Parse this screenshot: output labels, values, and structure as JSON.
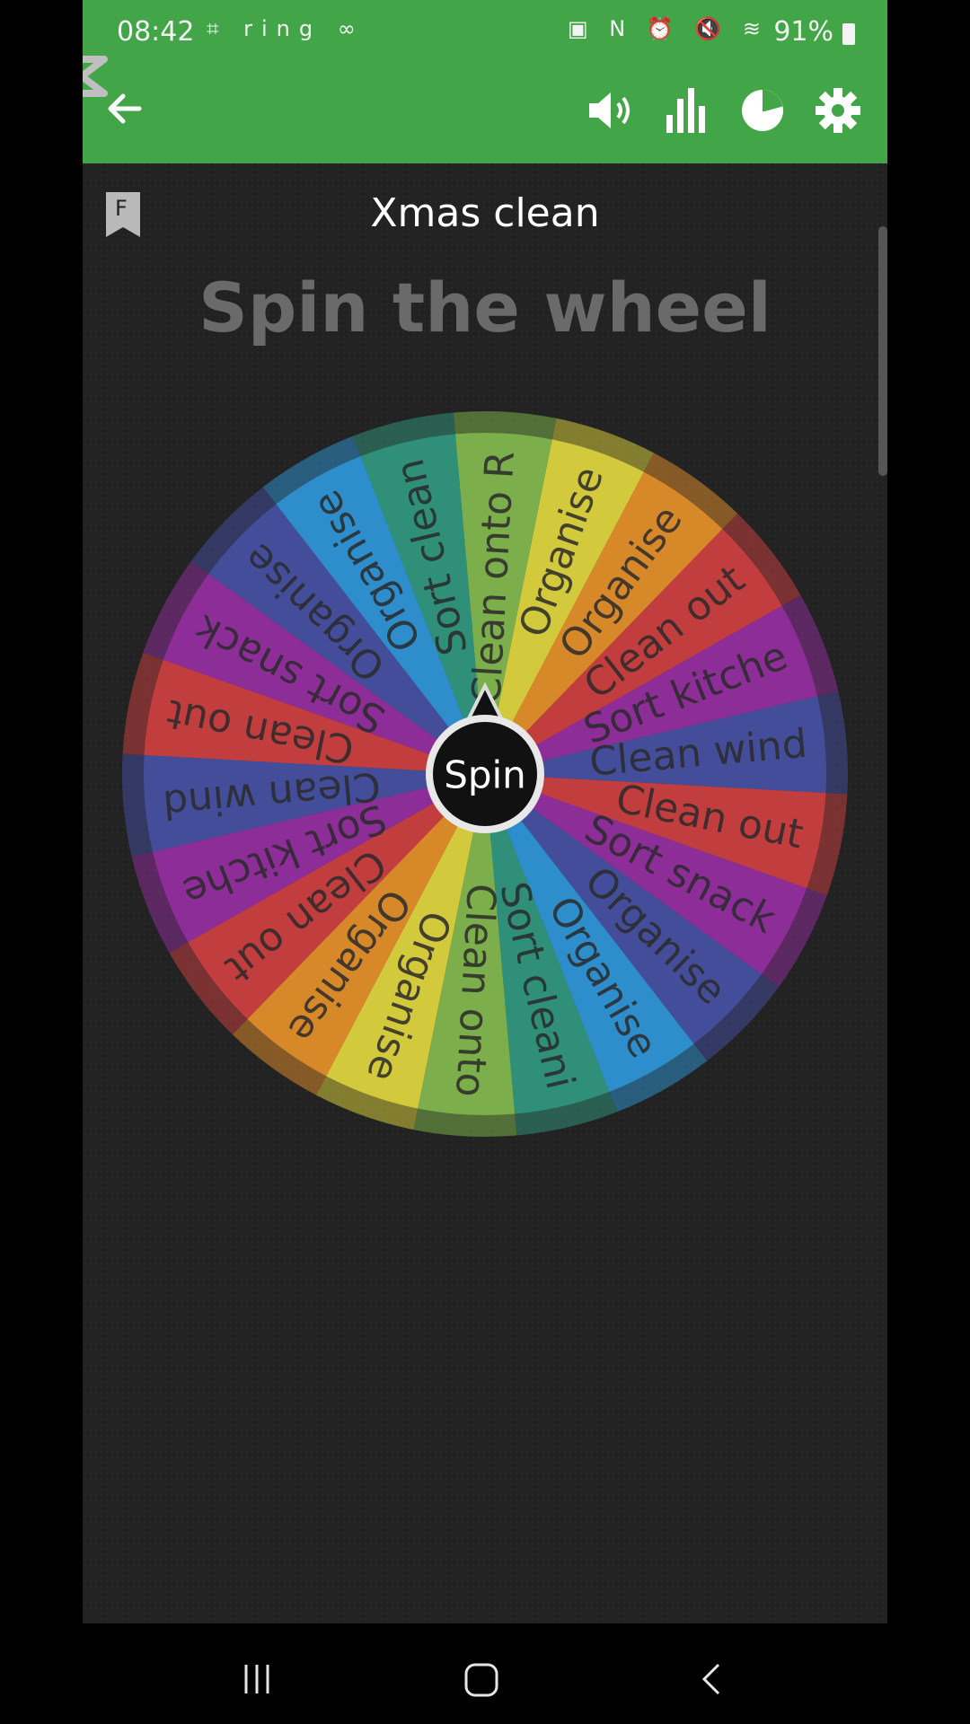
{
  "status_bar": {
    "time": "08:42",
    "left_icons": "⌗ ring ∞",
    "right_icons": "▣ N ⏰ 🔇 ≋",
    "battery": "91%"
  },
  "toolbar": {
    "back_icon": "arrow-left-icon",
    "sound_icon": "speaker-icon",
    "stats_icon": "bar-chart-icon",
    "pie_icon": "pie-chart-icon",
    "settings_icon": "gear-icon"
  },
  "page": {
    "bookmark_letter": "F",
    "title": "Xmas clean",
    "subtitle": "Spin the wheel"
  },
  "wheel": {
    "spin_label": "Spin",
    "segments": [
      {
        "label": "Clean onto R",
        "color": "#7cae4b"
      },
      {
        "label": "Organise",
        "color": "#d3c93c"
      },
      {
        "label": "Organise",
        "color": "#d7892a"
      },
      {
        "label": "Clean out",
        "color": "#c23e3e"
      },
      {
        "label": "Sort kitche",
        "color": "#8d2d97"
      },
      {
        "label": "Clean wind",
        "color": "#444d9a"
      },
      {
        "label": "Clean out",
        "color": "#c23e3e"
      },
      {
        "label": "Sort snack",
        "color": "#8d2d97"
      },
      {
        "label": "Organise",
        "color": "#444d9a"
      },
      {
        "label": "Organise",
        "color": "#2e8ecb"
      },
      {
        "label": "Sort cleani",
        "color": "#2f8f79"
      },
      {
        "label": "Clean onto",
        "color": "#7cae4b"
      },
      {
        "label": "Organise",
        "color": "#d3c93c"
      },
      {
        "label": "Organise",
        "color": "#d7892a"
      },
      {
        "label": "Clean out",
        "color": "#c23e3e"
      },
      {
        "label": "Sort kitche",
        "color": "#8d2d97"
      },
      {
        "label": "Clean wind",
        "color": "#444d9a"
      },
      {
        "label": "Clean out",
        "color": "#c23e3e"
      },
      {
        "label": "Sort snack",
        "color": "#8d2d97"
      },
      {
        "label": "Organise",
        "color": "#444d9a"
      },
      {
        "label": "Organise",
        "color": "#2e8ecb"
      },
      {
        "label": "Sort clean",
        "color": "#2f8f79"
      }
    ]
  },
  "nav": {
    "recents_icon": "recents-icon",
    "home_icon": "home-icon",
    "back_icon": "back-icon"
  }
}
